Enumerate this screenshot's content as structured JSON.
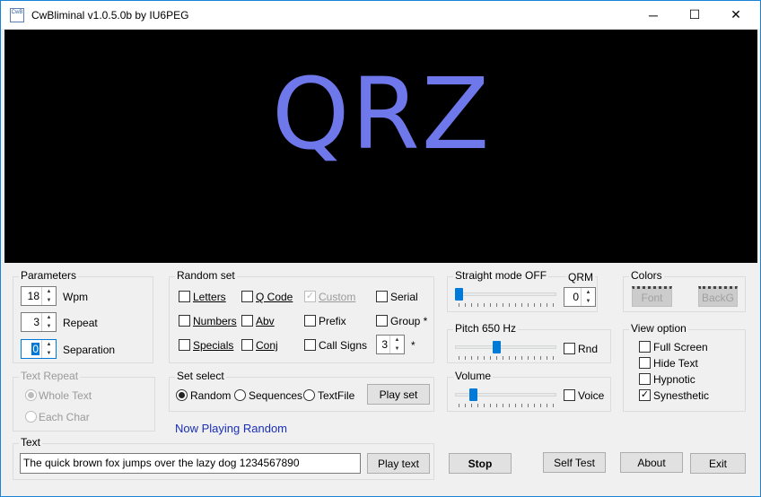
{
  "titlebar": {
    "icon_text": "CwB",
    "title": "CwBliminal v1.0.5.0b by IU6PEG",
    "minimize": "─",
    "maximize": "☐",
    "close": "✕"
  },
  "display": {
    "text": "QRZ",
    "text_color": "#6f78ea",
    "background": "#000000"
  },
  "parameters": {
    "label": "Parameters",
    "wpm_value": "18",
    "wpm_label": "Wpm",
    "repeat_value": "3",
    "repeat_label": "Repeat",
    "separation_value": "0",
    "separation_label": "Separation"
  },
  "text_repeat": {
    "label": "Text Repeat",
    "whole": "Whole Text",
    "each": "Each Char",
    "selected": "Whole Text"
  },
  "random_set": {
    "label": "Random set",
    "letters": "Letters",
    "numbers": "Numbers",
    "specials": "Specials",
    "qcode": "Q Code",
    "abv": "Abv",
    "conj": "Conj",
    "custom": "Custom",
    "prefix": "Prefix",
    "callsigns": "Call Signs",
    "serial": "Serial",
    "group": "Group *",
    "group_value": "3",
    "star": "*"
  },
  "set_select": {
    "label": "Set select",
    "random": "Random",
    "sequences": "Sequences",
    "textfile": "TextFile",
    "play_set": "Play set",
    "selected": "Random"
  },
  "now_playing": "Now Playing Random",
  "text_section": {
    "label": "Text",
    "value": "The quick brown fox jumps over the lazy dog 1234567890",
    "play_text": "Play text"
  },
  "straight": {
    "label": "Straight mode OFF",
    "qrm_label": "QRM",
    "qrm_value": "0"
  },
  "pitch": {
    "label": "Pitch 650 Hz",
    "rnd": "Rnd"
  },
  "volume": {
    "label": "Volume",
    "voice": "Voice"
  },
  "colors": {
    "label": "Colors",
    "font": "Font",
    "backg": "BackG"
  },
  "view_option": {
    "label": "View option",
    "full_screen": "Full Screen",
    "hide_text": "Hide Text",
    "hypnotic": "Hypnotic",
    "synesthetic": "Synesthetic"
  },
  "buttons": {
    "stop": "Stop",
    "self_test": "Self Test",
    "about": "About",
    "exit": "Exit"
  },
  "checks": {
    "custom": "✓",
    "synesthetic": "✓"
  },
  "spin_arrows": {
    "up": "▲",
    "down": "▼"
  }
}
